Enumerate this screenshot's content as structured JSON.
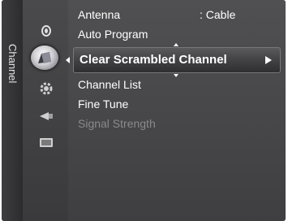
{
  "menu": {
    "category_label": "Channel",
    "icons": [
      {
        "name": "antenna-icon",
        "active": false
      },
      {
        "name": "channel-icon",
        "active": true
      },
      {
        "name": "setup-gear-icon",
        "active": false
      },
      {
        "name": "input-icon",
        "active": false
      },
      {
        "name": "application-icon",
        "active": false
      }
    ],
    "items": [
      {
        "label": "Antenna",
        "value": ": Cable"
      },
      {
        "label": "Auto Program"
      },
      {
        "label": "Clear Scrambled Channel",
        "selected": true
      },
      {
        "label": "Channel List"
      },
      {
        "label": "Fine Tune"
      },
      {
        "label": "Signal Strength",
        "disabled": true
      }
    ]
  },
  "colors": {
    "text": "#ffffff",
    "disabled_text": "#8a8a8a",
    "panel": "#4a4a4c"
  }
}
